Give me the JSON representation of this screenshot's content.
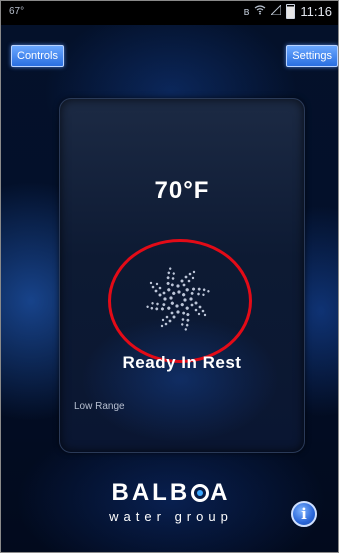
{
  "statusbar": {
    "left_text": "67°",
    "time": "11:16",
    "icons": [
      "bluetooth-icon",
      "wifi-icon",
      "signal-icon",
      "battery-icon"
    ]
  },
  "header": {
    "controls_label": "Controls",
    "settings_label": "Settings"
  },
  "panel": {
    "temperature": "70°F",
    "status": "Ready In Rest",
    "range": "Low Range"
  },
  "logo": {
    "brand_left": "BALB",
    "brand_right": "A",
    "tagline": "water group"
  },
  "info_button": {
    "symbol": "i"
  },
  "colors": {
    "accent_button": "#2a6fe0",
    "highlight_ring": "#e30b17",
    "background": "#04112a"
  }
}
